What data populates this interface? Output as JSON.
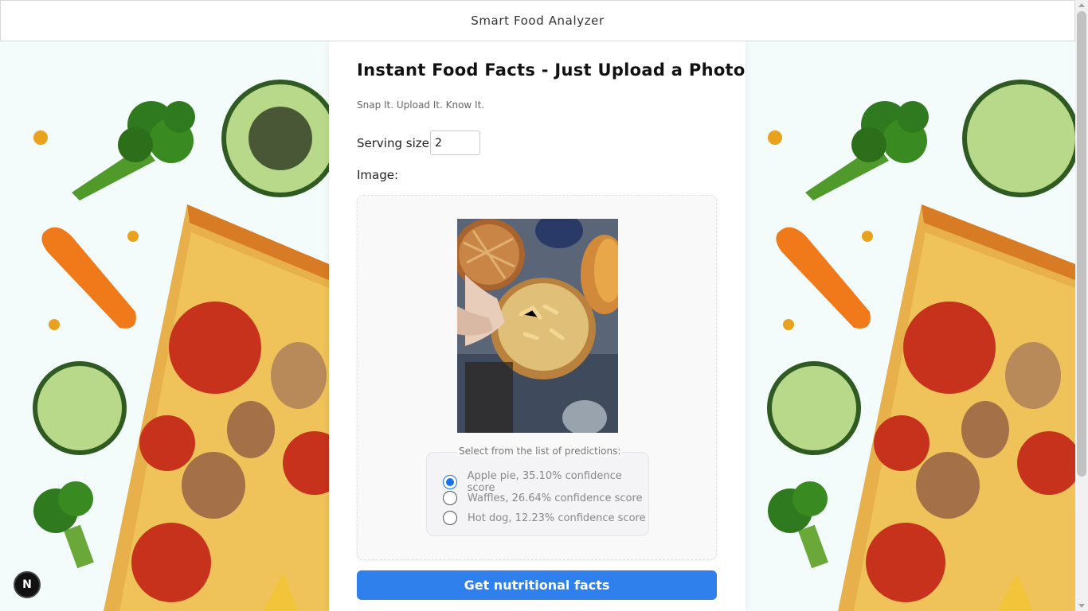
{
  "header": {
    "title": "Smart Food Analyzer"
  },
  "panel": {
    "heading": "Instant Food Facts - Just Upload a Photo",
    "subtitle": "Snap It. Upload It. Know It.",
    "serving_label": "Serving size:",
    "serving_value": "2",
    "image_label": "Image:"
  },
  "predictions": {
    "legend": "Select from the list of predictions:",
    "items": [
      {
        "label": "Apple pie, 35.10% confidence score",
        "selected": true
      },
      {
        "label": "Waffles, 26.64% confidence score",
        "selected": false
      },
      {
        "label": "Hot dog, 12.23% confidence score",
        "selected": false
      }
    ]
  },
  "submit": {
    "label": "Get nutritional facts"
  },
  "badge": {
    "label": "N"
  },
  "colors": {
    "accent": "#2f80ed",
    "radio_selected": "#1a73e8",
    "background": "#f4fbfb"
  }
}
